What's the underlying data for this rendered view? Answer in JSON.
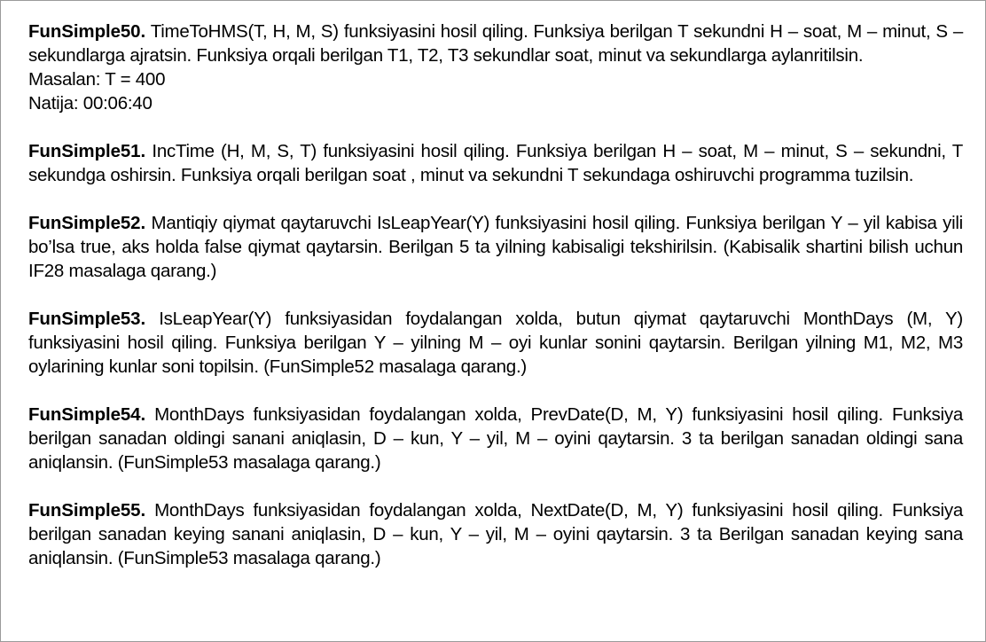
{
  "tasks": [
    {
      "title": "FunSimple50.",
      "text": "TimeToHMS(T, H, M, S) funksiyasini hosil qiling. Funksiya berilgan T sekundni H – soat, M – minut, S – sekundlarga ajratsin. Funksiya orqali berilgan T1, T2, T3 sekundlar soat, minut va sekundlarga aylanritilsin.",
      "example": "Masalan: T = 400",
      "result": "Natija: 00:06:40"
    },
    {
      "title": "FunSimple51.",
      "text": "IncTime (H, M, S, T) funksiyasini hosil qiling. Funksiya berilgan H – soat, M – minut, S – sekundni, T sekundga oshirsin. Funksiya orqali berilgan soat , minut va sekundni T sekundaga oshiruvchi programma tuzilsin."
    },
    {
      "title": "FunSimple52.",
      "text": "Mantiqiy qiymat qaytaruvchi IsLeapYear(Y) funksiyasini hosil qiling. Funksiya berilgan Y – yil kabisa yili bo’lsa true, aks holda false qiymat qaytarsin. Berilgan 5 ta yilning kabisaligi tekshirilsin. (Kabisalik shartini bilish uchun IF28 masalaga qarang.)"
    },
    {
      "title": "FunSimple53.",
      "text": "IsLeapYear(Y)  funksiyasidan foydalangan xolda, butun qiymat qaytaruvchi MonthDays (M, Y) funksiyasini hosil qiling. Funksiya berilgan Y – yilning M – oyi kunlar sonini qaytarsin. Berilgan yilning M1, M2, M3 oylarining kunlar soni topilsin. (FunSimple52 masalaga qarang.)"
    },
    {
      "title": "FunSimple54.",
      "text": "MonthDays funksiyasidan foydalangan xolda, PrevDate(D, M, Y) funksiyasini hosil qiling. Funksiya berilgan sanadan oldingi sanani aniqlasin, D – kun, Y – yil, M – oyini qaytarsin. 3 ta berilgan sanadan oldingi sana aniqlansin. (FunSimple53 masalaga qarang.)"
    },
    {
      "title": "FunSimple55.",
      "text": "MonthDays funksiyasidan foydalangan xolda, NextDate(D, M, Y) funksiyasini hosil qiling. Funksiya berilgan sanadan keying sanani aniqlasin, D – kun, Y – yil, M – oyini qaytarsin. 3 ta Berilgan sanadan keying sana aniqlansin. (FunSimple53 masalaga qarang.)"
    }
  ]
}
